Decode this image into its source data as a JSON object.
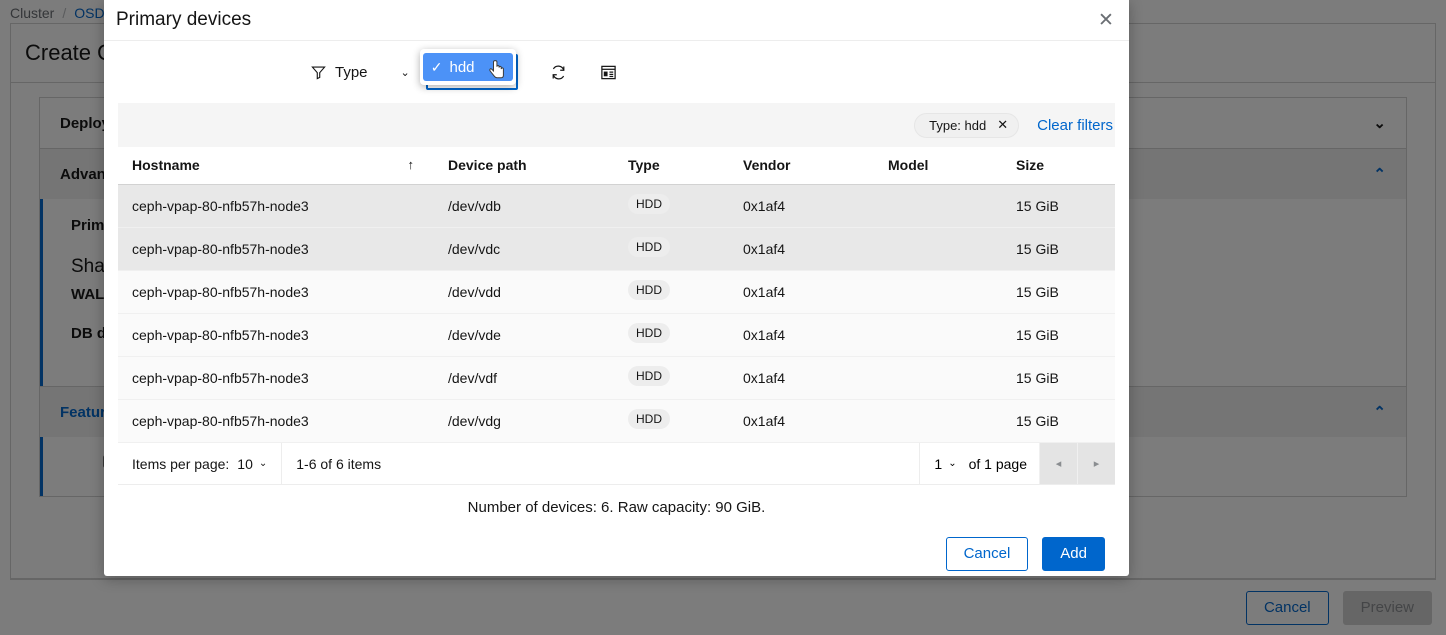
{
  "background": {
    "breadcrumb": {
      "root": "Cluster",
      "separator": "/",
      "current": "OSDs"
    },
    "page_title": "Create OSDs",
    "accordion": [
      {
        "label": "Deployment options",
        "chevron": "⌄",
        "state": "collapsed"
      },
      {
        "label": "Advanced",
        "chevron": "⌃",
        "state": "expanded"
      }
    ],
    "advanced_body": {
      "primary_label": "Primary devices",
      "shared_label": "Shared devices",
      "wal_label": "WAL devices",
      "db_label": "DB devices"
    },
    "features": {
      "label": "Features",
      "chevron": "⌃",
      "checkbox_label": "Encryption",
      "checked": false
    },
    "footer": {
      "cancel_label": "Cancel",
      "preview_label": "Preview"
    }
  },
  "modal": {
    "title": "Primary devices",
    "close_icon": "✕",
    "toolbar": {
      "filter_icon": "funnel-icon",
      "filter_label": "Type",
      "filter_caret": "⌄",
      "select_value": "hdd",
      "select_check": "✓",
      "refresh_icon": "refresh-icon",
      "columns_icon": "table-columns-icon"
    },
    "chipbar": {
      "chip_label": "Type: hdd",
      "chip_remove": "✕",
      "clear_filters_label": "Clear filters"
    },
    "table": {
      "columns": [
        "Hostname",
        "Device path",
        "Type",
        "Vendor",
        "Model",
        "Size"
      ],
      "sort_indicator": "↑",
      "sort_column": "Hostname",
      "rows": [
        {
          "hostname": "ceph-vpap-80-nfb57h-node3",
          "path": "/dev/vdb",
          "type": "HDD",
          "vendor": "0x1af4",
          "model": "",
          "size": "15 GiB"
        },
        {
          "hostname": "ceph-vpap-80-nfb57h-node3",
          "path": "/dev/vdc",
          "type": "HDD",
          "vendor": "0x1af4",
          "model": "",
          "size": "15 GiB"
        },
        {
          "hostname": "ceph-vpap-80-nfb57h-node3",
          "path": "/dev/vdd",
          "type": "HDD",
          "vendor": "0x1af4",
          "model": "",
          "size": "15 GiB"
        },
        {
          "hostname": "ceph-vpap-80-nfb57h-node3",
          "path": "/dev/vde",
          "type": "HDD",
          "vendor": "0x1af4",
          "model": "",
          "size": "15 GiB"
        },
        {
          "hostname": "ceph-vpap-80-nfb57h-node3",
          "path": "/dev/vdf",
          "type": "HDD",
          "vendor": "0x1af4",
          "model": "",
          "size": "15 GiB"
        },
        {
          "hostname": "ceph-vpap-80-nfb57h-node3",
          "path": "/dev/vdg",
          "type": "HDD",
          "vendor": "0x1af4",
          "model": "",
          "size": "15 GiB"
        }
      ]
    },
    "pagination": {
      "items_per_page_label": "Items per page:",
      "items_per_page_value": "10",
      "caret": "⌄",
      "range_label": "1-6 of 6 items",
      "page_value": "1",
      "of_pages_label": "of 1 page",
      "prev_icon": "◂",
      "next_icon": "▸"
    },
    "summary": "Number of devices: 6. Raw capacity: 90 GiB.",
    "footer": {
      "cancel_label": "Cancel",
      "add_label": "Add"
    }
  },
  "colors": {
    "accent": "#0066cc",
    "select_highlight": "#4c92f7",
    "row_shade": "#e8e8e8",
    "chip_bg": "#f0f0f0"
  }
}
